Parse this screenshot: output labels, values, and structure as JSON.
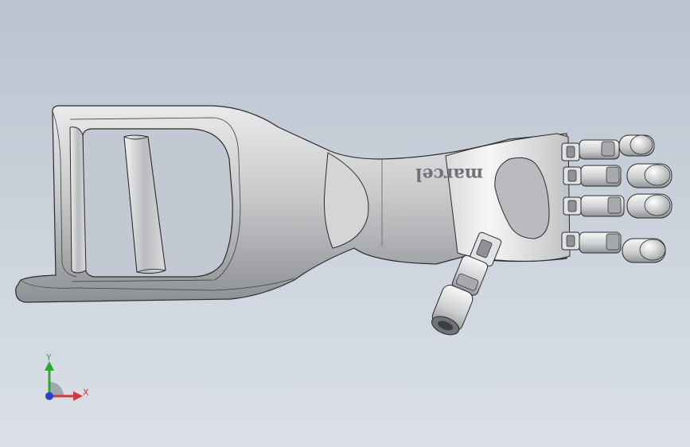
{
  "model": {
    "engraving": "marcel"
  },
  "triad": {
    "y_label": "Y",
    "x_label": "X",
    "colors": {
      "y": "#2fa82f",
      "x": "#d23a3a",
      "z": "#2a3fd0"
    }
  },
  "colors": {
    "background_top": "#b9c3cf",
    "background_bottom": "#dbe0e7",
    "part_light": "#f4f4f4",
    "part_shade": "#9a9da1",
    "edge": "#2b2b2b"
  }
}
